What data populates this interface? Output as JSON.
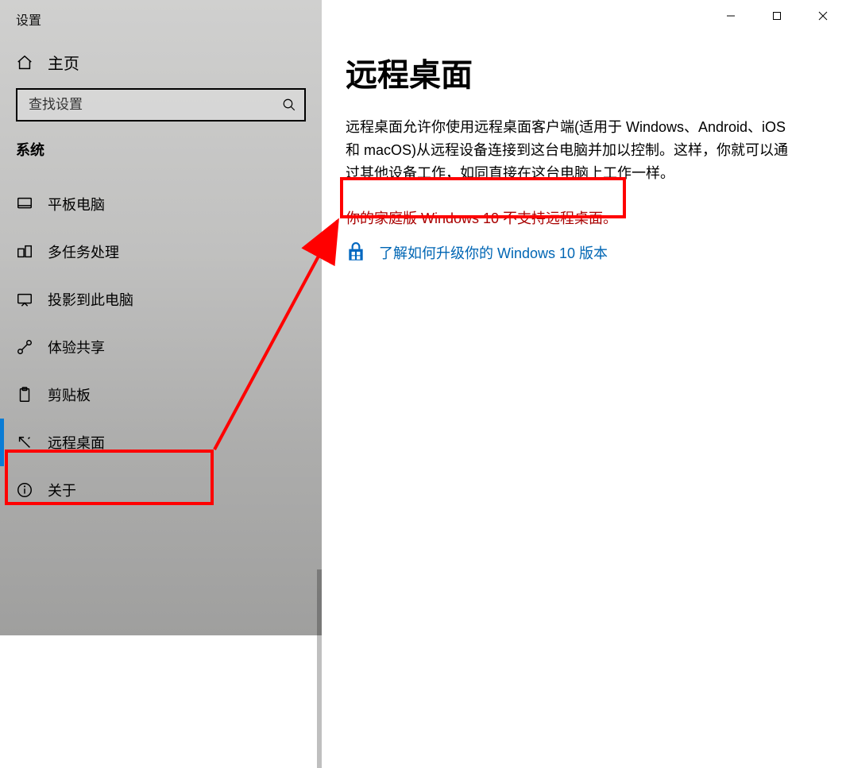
{
  "window": {
    "title": "设置"
  },
  "home": {
    "label": "主页"
  },
  "search": {
    "placeholder": "查找设置"
  },
  "section": {
    "title": "系统"
  },
  "sidebar": {
    "items": [
      {
        "label": "平板电脑"
      },
      {
        "label": "多任务处理"
      },
      {
        "label": "投影到此电脑"
      },
      {
        "label": "体验共享"
      },
      {
        "label": "剪贴板"
      },
      {
        "label": "远程桌面"
      },
      {
        "label": "关于"
      }
    ],
    "selected_index": 5
  },
  "page": {
    "title": "远程桌面",
    "description": "远程桌面允许你使用远程桌面客户端(适用于 Windows、Android、iOS 和 macOS)从远程设备连接到这台电脑并加以控制。这样，你就可以通过其他设备工作，如同直接在这台电脑上工作一样。",
    "warning": "你的家庭版 Windows 10 不支持远程桌面。",
    "upgrade_link": "了解如何升级你的 Windows 10 版本"
  }
}
